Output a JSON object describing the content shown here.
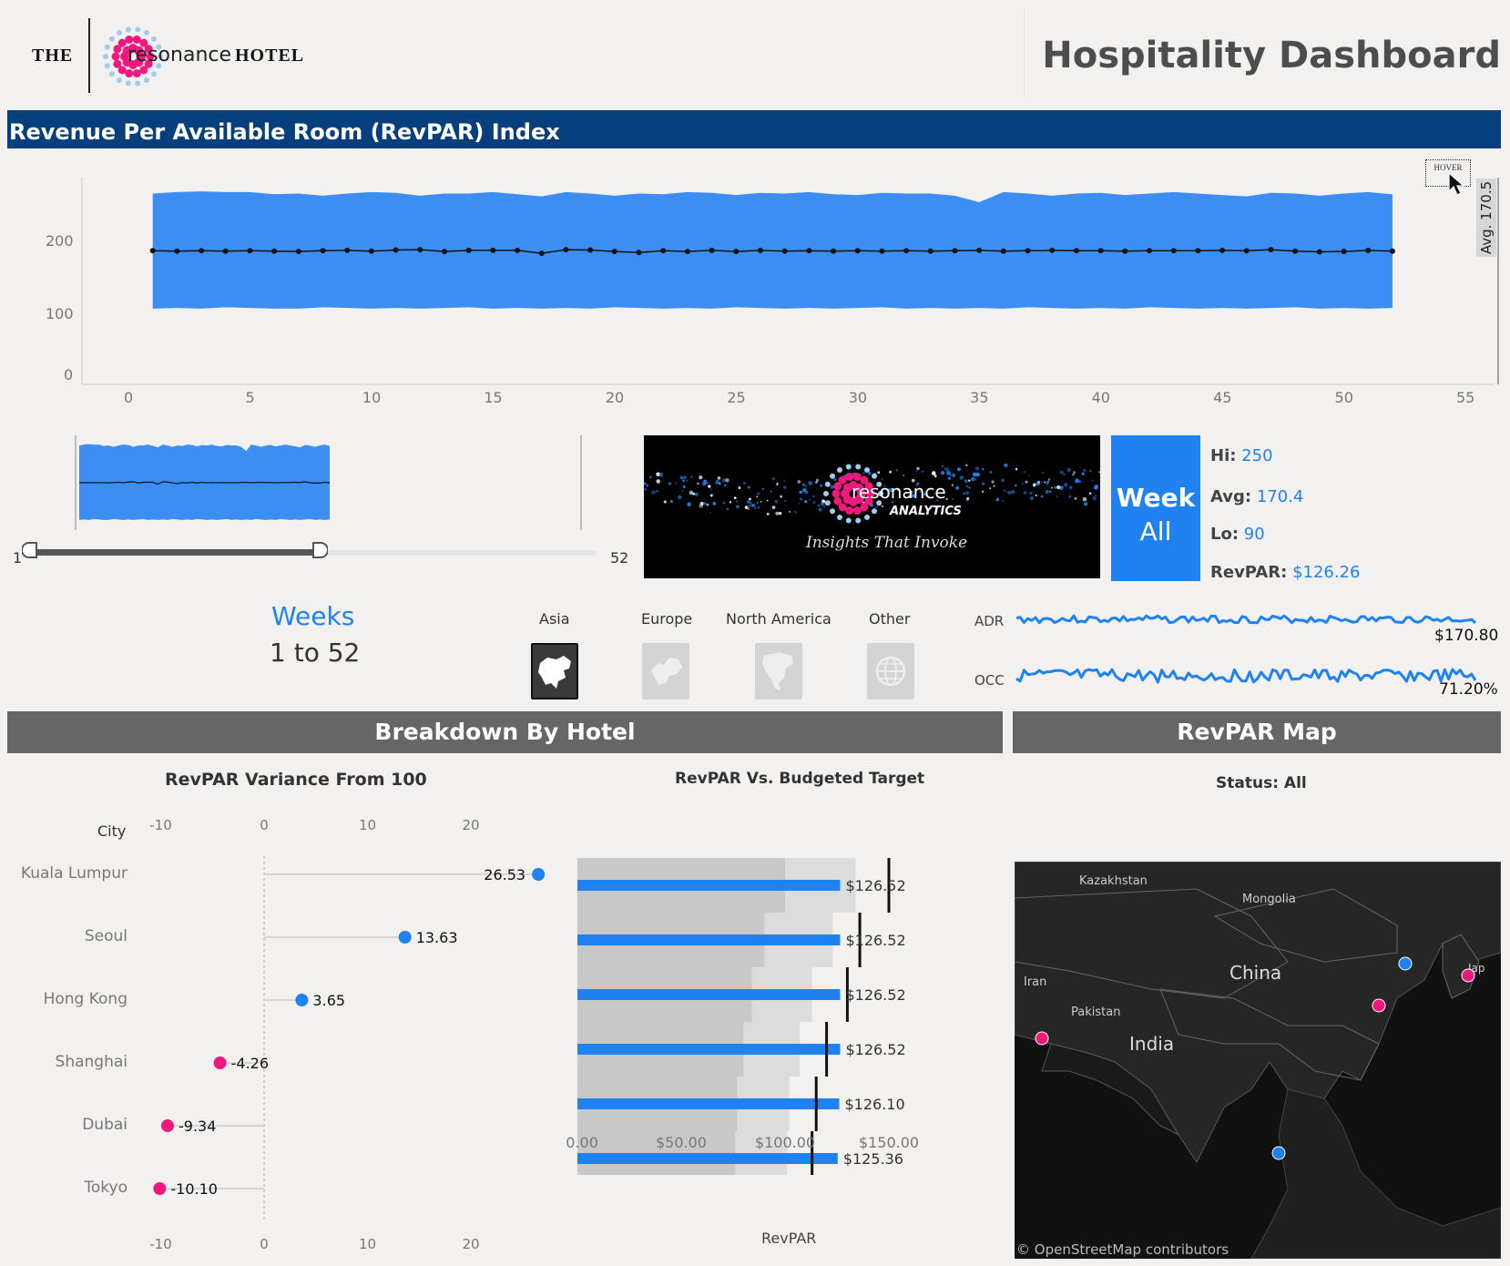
{
  "header": {
    "brand_the": "THE",
    "brand_name": "resonance",
    "brand_hotel": "HOTEL",
    "title": "Hospitality Dashboard"
  },
  "revpar_index": {
    "section_title": "Revenue Per Available Room (RevPAR) Index",
    "hover_label": "HOVER",
    "avg_label": "Avg. 170.5",
    "y_ticks": [
      "200",
      "100",
      "0"
    ],
    "x_ticks": [
      "0",
      "5",
      "10",
      "15",
      "20",
      "25",
      "30",
      "35",
      "40",
      "45",
      "50",
      "55"
    ]
  },
  "chart_data": {
    "type": "area",
    "title": "Revenue Per Available Room (RevPAR) Index",
    "xlabel": "",
    "ylabel": "",
    "xlim": [
      0,
      55
    ],
    "ylim": [
      0,
      290
    ],
    "x": [
      1,
      2,
      3,
      4,
      5,
      6,
      7,
      8,
      9,
      10,
      11,
      12,
      13,
      14,
      15,
      16,
      17,
      18,
      19,
      20,
      21,
      22,
      23,
      24,
      25,
      26,
      27,
      28,
      29,
      30,
      31,
      32,
      33,
      34,
      35,
      36,
      37,
      38,
      39,
      40,
      41,
      42,
      43,
      44,
      45,
      46,
      47,
      48,
      49,
      50,
      51,
      52
    ],
    "series": [
      {
        "values": [
          250,
          252,
          253,
          252,
          252,
          249,
          250,
          247,
          250,
          252,
          251,
          247,
          250,
          250,
          252,
          249,
          246,
          252,
          250,
          247,
          250,
          249,
          252,
          251,
          248,
          251,
          250,
          252,
          249,
          248,
          251,
          250,
          250,
          247,
          238,
          252,
          250,
          247,
          250,
          251,
          248,
          250,
          252,
          250,
          248,
          246,
          251,
          250,
          247,
          250,
          252,
          249
        ]
      },
      {
        "values": [
          90,
          91,
          90,
          92,
          91,
          90,
          90,
          92,
          91,
          90,
          91,
          90,
          91,
          92,
          90,
          91,
          90,
          91,
          90,
          92,
          91,
          90,
          91,
          90,
          92,
          91,
          90,
          91,
          90,
          91,
          92,
          90,
          91,
          90,
          91,
          90,
          92,
          91,
          90,
          91,
          90,
          92,
          91,
          90,
          91,
          90,
          91,
          92,
          90,
          91,
          90,
          91
        ]
      },
      {
        "values": [
          170.5,
          170,
          170.5,
          170,
          170.5,
          170,
          169.5,
          170.5,
          171,
          170,
          171.5,
          172,
          169.5,
          171,
          171,
          171,
          167,
          172,
          171.5,
          169.5,
          168,
          170.5,
          169.5,
          171,
          169.5,
          171,
          170,
          170.5,
          170,
          170.5,
          170,
          170.5,
          170,
          170.5,
          171,
          170,
          170.5,
          171,
          170.5,
          170.5,
          170,
          170.5,
          170.5,
          170.5,
          171,
          170.5,
          172,
          170,
          169,
          169.5,
          171,
          170
        ]
      }
    ]
  },
  "slider": {
    "min_label": "1",
    "max_label": "52"
  },
  "week_card": {
    "line1": "Week",
    "line2": "All",
    "hi_label": "Hi:",
    "hi_value": "250",
    "avg_label": "Avg:",
    "avg_value": "170.4",
    "lo_label": "Lo:",
    "lo_value": "90",
    "revpar_label": "RevPAR:",
    "revpar_value": "$126.26"
  },
  "banner": {
    "logo_main": "resonance",
    "logo_sub": "ANALYTICS",
    "tagline": "Insights That Invoke"
  },
  "weeks_filter": {
    "title": "Weeks",
    "range": "1 to 52"
  },
  "regions": [
    {
      "label": "Asia",
      "selected": true,
      "icon": "asia-map-icon"
    },
    {
      "label": "Europe",
      "selected": false,
      "icon": "europe-map-icon"
    },
    {
      "label": "North America",
      "selected": false,
      "icon": "north-america-map-icon"
    },
    {
      "label": "Other",
      "selected": false,
      "icon": "globe-icon"
    }
  ],
  "kpis": {
    "adr_label": "ADR",
    "adr_value": "$170.80",
    "occ_label": "OCC",
    "occ_value": "71.20%"
  },
  "breakdown": {
    "section_title": "Breakdown By Hotel",
    "variance_title": "RevPAR Variance From 100",
    "city_header": "City",
    "variance_ticks": [
      "-10",
      "0",
      "10",
      "20"
    ],
    "cities": [
      "Kuala Lumpur",
      "Seoul",
      "Hong Kong",
      "Shanghai",
      "Dubai",
      "Tokyo"
    ],
    "variance_labels": [
      "26.53",
      "13.63",
      "3.65",
      "-4.26",
      "-9.34",
      "-10.10"
    ],
    "budget_title": "RevPAR Vs. Budgeted Target",
    "budget_labels": [
      "$126.52",
      "$126.52",
      "$126.52",
      "$126.52",
      "$126.10",
      "$125.36"
    ],
    "budget_ticks": [
      "$0.00",
      "$50.00",
      "$100.00",
      "$150.00"
    ],
    "budget_xlabel": "RevPAR"
  },
  "variance_data": {
    "values": [
      26.53,
      13.63,
      3.65,
      -4.26,
      -9.34,
      -10.1
    ],
    "positive_color": "#1f82f0",
    "negative_color": "#f0187c"
  },
  "budget_data": {
    "revpar": [
      126.52,
      126.52,
      126.52,
      126.52,
      126.1,
      125.36
    ],
    "target": [
      150,
      136,
      130,
      120,
      115,
      113
    ],
    "band_low": [
      100,
      90,
      84,
      80,
      77,
      76
    ],
    "band_high": [
      134,
      123,
      113,
      107,
      102,
      101
    ],
    "xlim": [
      0,
      170
    ]
  },
  "map": {
    "section_title": "RevPAR Map",
    "status": "Status: All",
    "labels": [
      "Kazakhstan",
      "Mongolia",
      "China",
      "Iran",
      "Pakistan",
      "India",
      "Jap"
    ],
    "attribution": "© OpenStreetMap contributors"
  },
  "colors": {
    "accent": "#1f82f0",
    "navy": "#073f7c",
    "magenta": "#f0187c",
    "section_gray": "#666666"
  }
}
